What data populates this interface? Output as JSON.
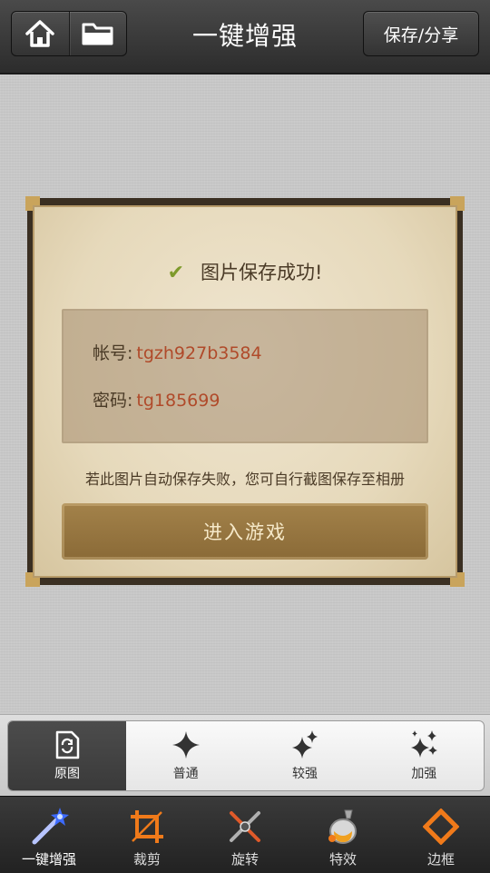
{
  "header": {
    "title": "一键增强",
    "save_label": "保存/分享",
    "home_icon": "home-icon",
    "folder_icon": "folder-icon"
  },
  "dialog": {
    "success_text": "图片保存成功!",
    "account_label": "帐号:",
    "account_value": "tgzh927b3584",
    "password_label": "密码:",
    "password_value": "tg185699",
    "hint": "若此图片自动保存失败，您可自行截图保存至相册",
    "enter_button": "进入游戏"
  },
  "enhance": {
    "items": [
      {
        "label": "原图",
        "icon": "original-icon",
        "selected": true
      },
      {
        "label": "普通",
        "icon": "sparkle-icon",
        "selected": false
      },
      {
        "label": "较强",
        "icon": "sparkles-icon",
        "selected": false
      },
      {
        "label": "加强",
        "icon": "sparkles-many-icon",
        "selected": false
      }
    ]
  },
  "toolbar": {
    "items": [
      {
        "label": "一键增强",
        "icon": "magic-wand-icon",
        "selected": true
      },
      {
        "label": "裁剪",
        "icon": "crop-icon",
        "selected": false
      },
      {
        "label": "旋转",
        "icon": "rotate-icon",
        "selected": false
      },
      {
        "label": "特效",
        "icon": "effects-icon",
        "selected": false
      },
      {
        "label": "边框",
        "icon": "frame-icon",
        "selected": false
      }
    ]
  },
  "colors": {
    "accent_value": "#b04a2a",
    "check": "#7e9a2b",
    "frame_orange": "#f07a1a"
  }
}
